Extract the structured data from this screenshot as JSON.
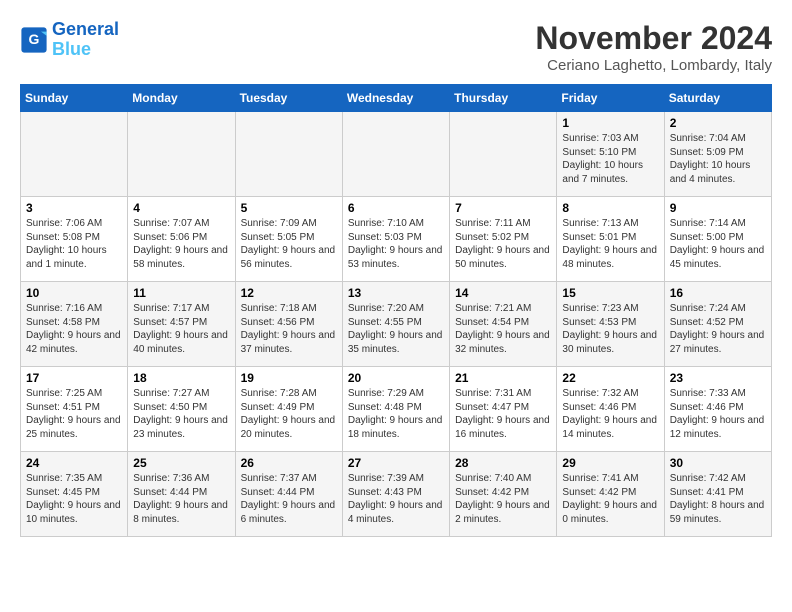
{
  "logo": {
    "line1": "General",
    "line2": "Blue"
  },
  "title": "November 2024",
  "location": "Ceriano Laghetto, Lombardy, Italy",
  "weekdays": [
    "Sunday",
    "Monday",
    "Tuesday",
    "Wednesday",
    "Thursday",
    "Friday",
    "Saturday"
  ],
  "weeks": [
    [
      {
        "day": "",
        "info": ""
      },
      {
        "day": "",
        "info": ""
      },
      {
        "day": "",
        "info": ""
      },
      {
        "day": "",
        "info": ""
      },
      {
        "day": "",
        "info": ""
      },
      {
        "day": "1",
        "info": "Sunrise: 7:03 AM\nSunset: 5:10 PM\nDaylight: 10 hours and 7 minutes."
      },
      {
        "day": "2",
        "info": "Sunrise: 7:04 AM\nSunset: 5:09 PM\nDaylight: 10 hours and 4 minutes."
      }
    ],
    [
      {
        "day": "3",
        "info": "Sunrise: 7:06 AM\nSunset: 5:08 PM\nDaylight: 10 hours and 1 minute."
      },
      {
        "day": "4",
        "info": "Sunrise: 7:07 AM\nSunset: 5:06 PM\nDaylight: 9 hours and 58 minutes."
      },
      {
        "day": "5",
        "info": "Sunrise: 7:09 AM\nSunset: 5:05 PM\nDaylight: 9 hours and 56 minutes."
      },
      {
        "day": "6",
        "info": "Sunrise: 7:10 AM\nSunset: 5:03 PM\nDaylight: 9 hours and 53 minutes."
      },
      {
        "day": "7",
        "info": "Sunrise: 7:11 AM\nSunset: 5:02 PM\nDaylight: 9 hours and 50 minutes."
      },
      {
        "day": "8",
        "info": "Sunrise: 7:13 AM\nSunset: 5:01 PM\nDaylight: 9 hours and 48 minutes."
      },
      {
        "day": "9",
        "info": "Sunrise: 7:14 AM\nSunset: 5:00 PM\nDaylight: 9 hours and 45 minutes."
      }
    ],
    [
      {
        "day": "10",
        "info": "Sunrise: 7:16 AM\nSunset: 4:58 PM\nDaylight: 9 hours and 42 minutes."
      },
      {
        "day": "11",
        "info": "Sunrise: 7:17 AM\nSunset: 4:57 PM\nDaylight: 9 hours and 40 minutes."
      },
      {
        "day": "12",
        "info": "Sunrise: 7:18 AM\nSunset: 4:56 PM\nDaylight: 9 hours and 37 minutes."
      },
      {
        "day": "13",
        "info": "Sunrise: 7:20 AM\nSunset: 4:55 PM\nDaylight: 9 hours and 35 minutes."
      },
      {
        "day": "14",
        "info": "Sunrise: 7:21 AM\nSunset: 4:54 PM\nDaylight: 9 hours and 32 minutes."
      },
      {
        "day": "15",
        "info": "Sunrise: 7:23 AM\nSunset: 4:53 PM\nDaylight: 9 hours and 30 minutes."
      },
      {
        "day": "16",
        "info": "Sunrise: 7:24 AM\nSunset: 4:52 PM\nDaylight: 9 hours and 27 minutes."
      }
    ],
    [
      {
        "day": "17",
        "info": "Sunrise: 7:25 AM\nSunset: 4:51 PM\nDaylight: 9 hours and 25 minutes."
      },
      {
        "day": "18",
        "info": "Sunrise: 7:27 AM\nSunset: 4:50 PM\nDaylight: 9 hours and 23 minutes."
      },
      {
        "day": "19",
        "info": "Sunrise: 7:28 AM\nSunset: 4:49 PM\nDaylight: 9 hours and 20 minutes."
      },
      {
        "day": "20",
        "info": "Sunrise: 7:29 AM\nSunset: 4:48 PM\nDaylight: 9 hours and 18 minutes."
      },
      {
        "day": "21",
        "info": "Sunrise: 7:31 AM\nSunset: 4:47 PM\nDaylight: 9 hours and 16 minutes."
      },
      {
        "day": "22",
        "info": "Sunrise: 7:32 AM\nSunset: 4:46 PM\nDaylight: 9 hours and 14 minutes."
      },
      {
        "day": "23",
        "info": "Sunrise: 7:33 AM\nSunset: 4:46 PM\nDaylight: 9 hours and 12 minutes."
      }
    ],
    [
      {
        "day": "24",
        "info": "Sunrise: 7:35 AM\nSunset: 4:45 PM\nDaylight: 9 hours and 10 minutes."
      },
      {
        "day": "25",
        "info": "Sunrise: 7:36 AM\nSunset: 4:44 PM\nDaylight: 9 hours and 8 minutes."
      },
      {
        "day": "26",
        "info": "Sunrise: 7:37 AM\nSunset: 4:44 PM\nDaylight: 9 hours and 6 minutes."
      },
      {
        "day": "27",
        "info": "Sunrise: 7:39 AM\nSunset: 4:43 PM\nDaylight: 9 hours and 4 minutes."
      },
      {
        "day": "28",
        "info": "Sunrise: 7:40 AM\nSunset: 4:42 PM\nDaylight: 9 hours and 2 minutes."
      },
      {
        "day": "29",
        "info": "Sunrise: 7:41 AM\nSunset: 4:42 PM\nDaylight: 9 hours and 0 minutes."
      },
      {
        "day": "30",
        "info": "Sunrise: 7:42 AM\nSunset: 4:41 PM\nDaylight: 8 hours and 59 minutes."
      }
    ]
  ]
}
